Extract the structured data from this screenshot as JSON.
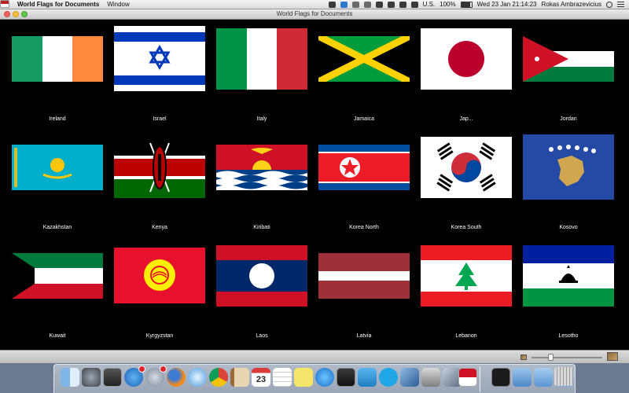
{
  "menubar": {
    "app_name": "World Flags for Documents",
    "menus": [
      "Window"
    ],
    "input_source": "U.S.",
    "battery": "100%",
    "clock": "Wed 23 Jan  21:14:23",
    "user": "Rokas Ambrazevicius"
  },
  "window": {
    "title": "World Flags for Documents"
  },
  "flags": [
    {
      "name": "Ireland"
    },
    {
      "name": "Israel"
    },
    {
      "name": "Italy"
    },
    {
      "name": "Jamaica"
    },
    {
      "name": "Jap..."
    },
    {
      "name": "Jordan"
    },
    {
      "name": "Kazakhstan"
    },
    {
      "name": "Kenya"
    },
    {
      "name": "Kiribati"
    },
    {
      "name": "Korea North"
    },
    {
      "name": "Korea South"
    },
    {
      "name": "Kosovo"
    },
    {
      "name": "Kuwait"
    },
    {
      "name": "Kyrgyzstan"
    },
    {
      "name": "Laos"
    },
    {
      "name": "Latvia"
    },
    {
      "name": "Lebanon"
    },
    {
      "name": "Lesotho"
    }
  ],
  "zoom": {
    "level": 0.27
  },
  "dock": {
    "items": [
      "finder-icon",
      "dashboard-icon",
      "mission-control-icon",
      "app-store-icon",
      "launchpad-icon",
      "firefox-icon",
      "safari-icon",
      "chrome-icon",
      "contacts-icon",
      "calendar-icon",
      "reminders-icon",
      "stickies-icon",
      "itunes-icon",
      "photo-booth-icon",
      "tweetbot-icon",
      "skype-icon",
      "xcode-icon",
      "dvd-player-icon",
      "instruments-icon",
      "flags-app-icon",
      "activity-monitor-icon",
      "applications-stack-icon",
      "documents-stack-icon",
      "downloads-stack-icon",
      "trash-icon"
    ],
    "calendar_day": "23"
  }
}
